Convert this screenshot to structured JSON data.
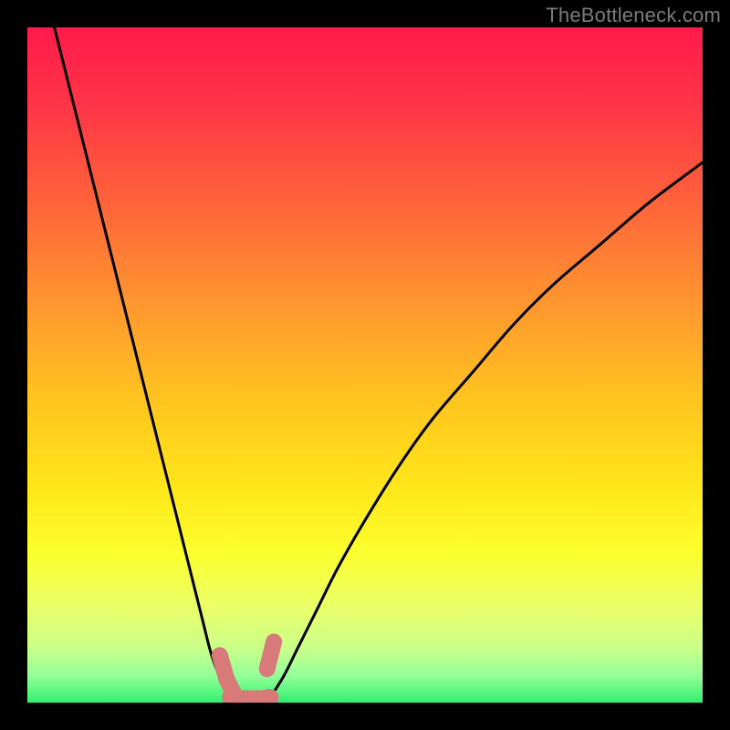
{
  "watermark": "TheBottleneck.com",
  "gradient_stops": [
    {
      "offset": 0.0,
      "color": "#ff1a4b"
    },
    {
      "offset": 0.12,
      "color": "#ff3646"
    },
    {
      "offset": 0.28,
      "color": "#ff6a39"
    },
    {
      "offset": 0.42,
      "color": "#ff9a2e"
    },
    {
      "offset": 0.55,
      "color": "#ffc41f"
    },
    {
      "offset": 0.68,
      "color": "#ffe61a"
    },
    {
      "offset": 0.78,
      "color": "#fbff2e"
    },
    {
      "offset": 0.86,
      "color": "#eaff6a"
    },
    {
      "offset": 0.92,
      "color": "#c9ff8a"
    },
    {
      "offset": 0.96,
      "color": "#95ff9a"
    },
    {
      "offset": 1.0,
      "color": "#33f06e"
    }
  ],
  "marker_color": "#d97a7a",
  "chart_data": {
    "type": "line",
    "title": "",
    "xlabel": "",
    "ylabel": "",
    "xlim": [
      0,
      100
    ],
    "ylim": [
      0,
      100
    ],
    "series": [
      {
        "name": "curve-left",
        "x": [
          4,
          6,
          8,
          10,
          12,
          14,
          16,
          18,
          20,
          22,
          24,
          26,
          27,
          28,
          29,
          30,
          31
        ],
        "values": [
          100,
          92,
          84,
          76,
          68,
          60,
          52,
          44,
          36,
          28,
          20,
          12,
          8,
          5,
          3,
          1.5,
          0.8
        ]
      },
      {
        "name": "curve-right",
        "x": [
          36,
          38,
          40,
          43,
          46,
          50,
          55,
          60,
          66,
          72,
          78,
          85,
          92,
          100
        ],
        "values": [
          0.8,
          4,
          8,
          14,
          20,
          27,
          35,
          42,
          49,
          56,
          62,
          68,
          74,
          80
        ]
      },
      {
        "name": "marker-left",
        "x": [
          28.5,
          29.5,
          30.5
        ],
        "values": [
          7,
          3.5,
          1.5
        ]
      },
      {
        "name": "marker-bottom",
        "x": [
          30,
          31.5,
          33,
          34.5,
          36
        ],
        "values": [
          0.8,
          0.6,
          0.6,
          0.6,
          0.8
        ]
      },
      {
        "name": "marker-right",
        "x": [
          35.5,
          36.5
        ],
        "values": [
          5,
          9
        ]
      }
    ]
  }
}
